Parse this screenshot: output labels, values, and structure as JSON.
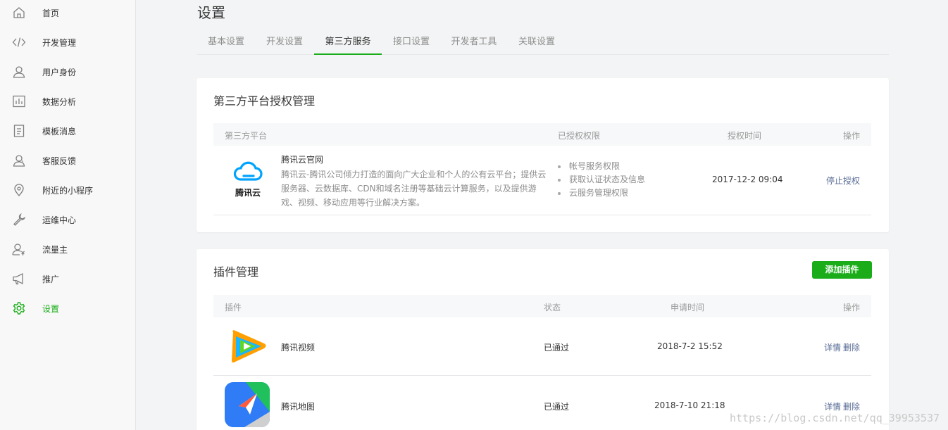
{
  "sidebar": {
    "items": [
      {
        "label": "首页",
        "icon": "home-icon"
      },
      {
        "label": "开发管理",
        "icon": "code-icon"
      },
      {
        "label": "用户身份",
        "icon": "user-icon"
      },
      {
        "label": "数据分析",
        "icon": "chart-icon"
      },
      {
        "label": "模板消息",
        "icon": "document-icon"
      },
      {
        "label": "客服反馈",
        "icon": "customer-service-icon"
      },
      {
        "label": "附近的小程序",
        "icon": "location-icon"
      },
      {
        "label": "运维中心",
        "icon": "wrench-icon"
      },
      {
        "label": "流量主",
        "icon": "user-money-icon"
      },
      {
        "label": "推广",
        "icon": "megaphone-icon"
      },
      {
        "label": "设置",
        "icon": "gear-icon",
        "active": true
      }
    ]
  },
  "page": {
    "title": "设置"
  },
  "tabs": [
    {
      "label": "基本设置"
    },
    {
      "label": "开发设置"
    },
    {
      "label": "第三方服务",
      "active": true
    },
    {
      "label": "接口设置"
    },
    {
      "label": "开发者工具"
    },
    {
      "label": "关联设置"
    }
  ],
  "third_party": {
    "title": "第三方平台授权管理",
    "columns": {
      "platform": "第三方平台",
      "permissions": "已授权权限",
      "time": "授权时间",
      "action": "操作"
    },
    "rows": [
      {
        "logo_text": "腾讯云",
        "name": "腾讯云官网",
        "description": "腾讯云-腾讯公司倾力打造的面向广大企业和个人的公有云平台；提供云服务器、云数据库、CDN和域名注册等基础云计算服务，以及提供游戏、视频、移动应用等行业解决方案。",
        "permissions": [
          "帐号服务权限",
          "获取认证状态及信息",
          "云服务管理权限"
        ],
        "time": "2017-12-2 09:04",
        "action": "停止授权"
      }
    ]
  },
  "plugins": {
    "title": "插件管理",
    "add_button": "添加插件",
    "columns": {
      "plugin": "插件",
      "status": "状态",
      "time": "申请时间",
      "action": "操作"
    },
    "rows": [
      {
        "name": "腾讯视频",
        "status": "已通过",
        "time": "2018-7-2 15:52",
        "detail": "详情",
        "delete": "删除"
      },
      {
        "name": "腾讯地图",
        "status": "已通过",
        "time": "2018-7-10 21:18",
        "detail": "详情",
        "delete": "删除"
      }
    ]
  },
  "watermark": "https://blog.csdn.net/qq_39953537",
  "colors": {
    "accent": "#1aad19",
    "link": "#576b95",
    "tencent_cloud_blue": "#00a3ff"
  }
}
